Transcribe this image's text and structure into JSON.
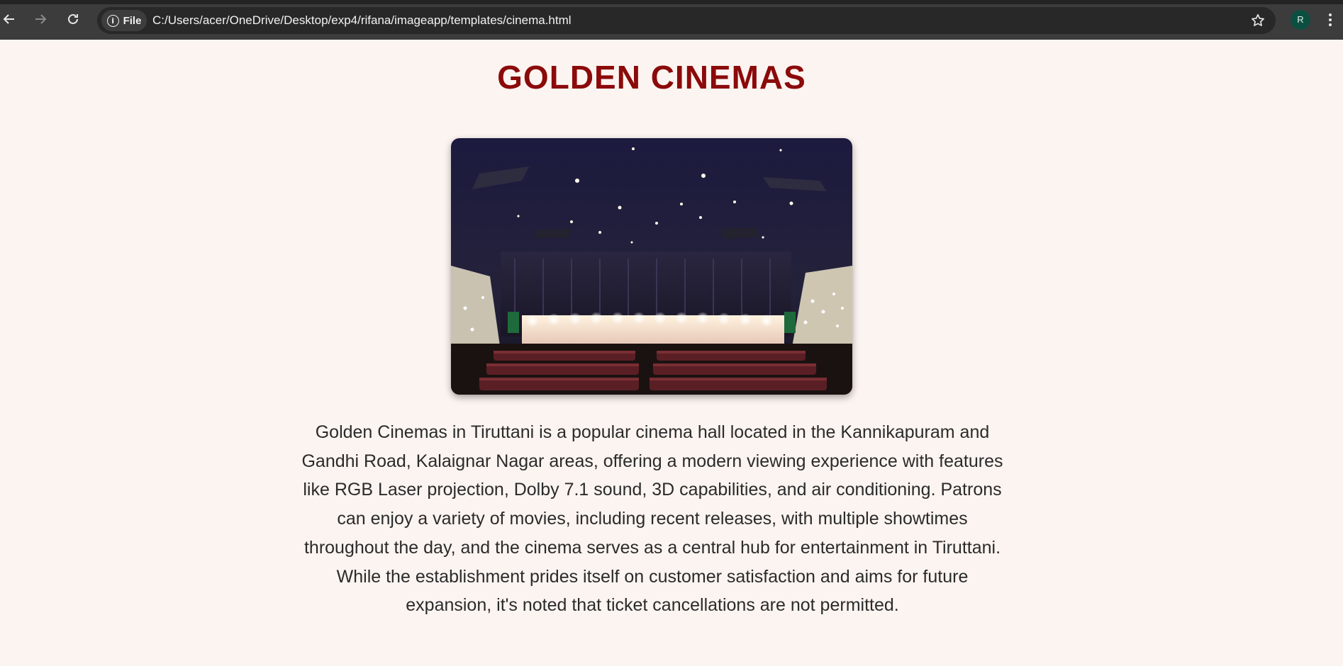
{
  "browser": {
    "chip_label": "File",
    "url": "C:/Users/acer/OneDrive/Desktop/exp4/rifana/imageapp/templates/cinema.html",
    "profile_initial": "R"
  },
  "page": {
    "title": "GOLDEN CINEMAS",
    "description": "Golden Cinemas in Tiruttani is a popular cinema hall located in the Kannikapuram and Gandhi Road, Kalaignar Nagar areas, offering a modern viewing experience with features like RGB Laser projection, Dolby 7.1 sound, 3D capabilities, and air conditioning. Patrons can enjoy a variety of movies, including recent releases, with multiple showtimes throughout the day, and the cinema serves as a central hub for entertainment in Tiruttani. While the establishment prides itself on customer satisfaction and aims for future expansion, it's noted that ticket cancellations are not permitted."
  },
  "colors": {
    "title": "#8b0a0a",
    "page_background": "#fcf4f0",
    "text": "#2b2b2b"
  }
}
